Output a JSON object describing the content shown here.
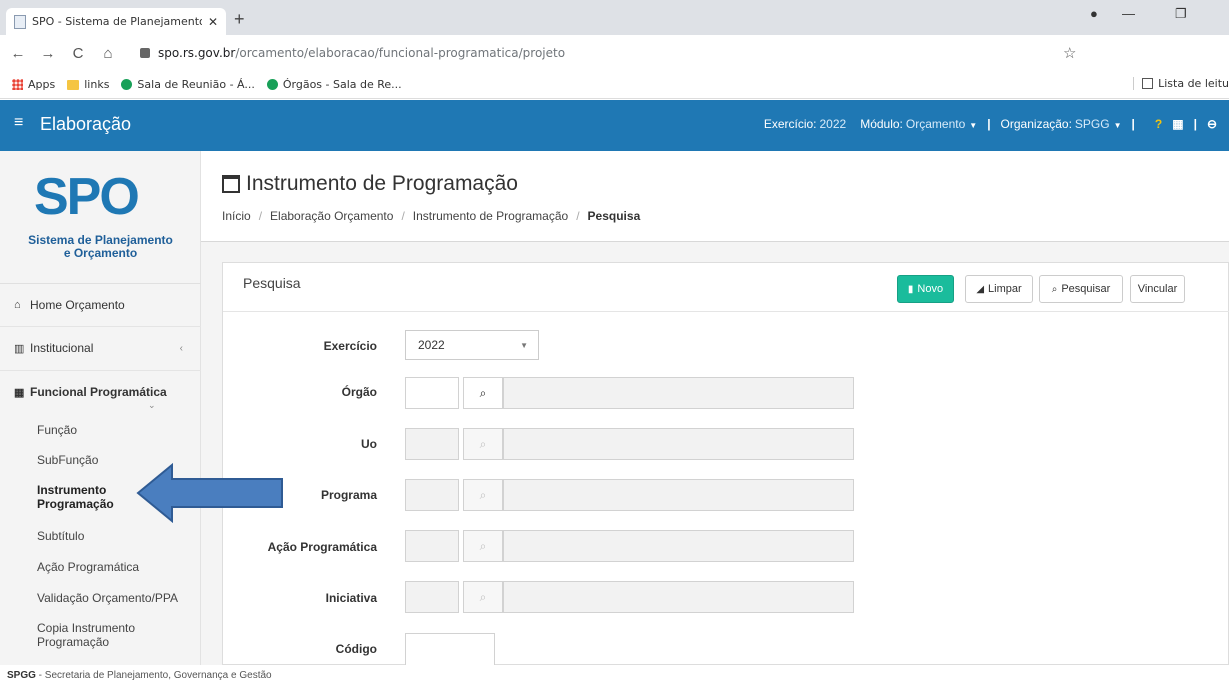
{
  "browser": {
    "tab_title": "SPO - Sistema de Planejamento e",
    "url_host": "spo.rs.gov.br",
    "url_path": "/orcamento/elaboracao/funcional-programatica/projeto",
    "bookmarks": [
      "Apps",
      "links",
      "Sala de Reunião - Á...",
      "Órgãos - Sala de Re..."
    ],
    "reading_list": "Lista de leitu"
  },
  "header": {
    "brand": "Elaboração",
    "exercicio_label": "Exercício:",
    "exercicio_value": "2022",
    "modulo_label": "Módulo:",
    "modulo_value": "Orçamento",
    "org_label": "Organização:",
    "org_value": "SPGG"
  },
  "logo": {
    "letters": "SPO",
    "tagline_1": "Sistema de Planejamento",
    "tagline_2": "e Orçamento"
  },
  "sidebar": {
    "home": "Home Orçamento",
    "institucional": "Institucional",
    "funcional": "Funcional Programática",
    "sub": [
      "Função",
      "SubFunção",
      "Instrumento",
      "Programação",
      "Subtítulo",
      "Ação Programática",
      "Validação Orçamento/PPA",
      "Copia Instrumento",
      "Programação"
    ]
  },
  "page": {
    "title": "Instrumento de Programação",
    "breadcrumb": [
      "Início",
      "Elaboração Orçamento",
      "Instrumento de Programação",
      "Pesquisa"
    ]
  },
  "panel": {
    "title": "Pesquisa",
    "btn_novo": "Novo",
    "btn_limpar": "Limpar",
    "btn_pesquisar": "Pesquisar",
    "btn_vincular": "Vincular"
  },
  "form": {
    "exercicio_label": "Exercício",
    "exercicio_value": "2022",
    "orgao_label": "Órgão",
    "uo_label": "Uo",
    "programa_label": "Programa",
    "acao_label": "Ação Programática",
    "iniciativa_label": "Iniciativa",
    "codigo_label": "Código"
  },
  "footer": {
    "abbr": "SPGG",
    "text": " - Secretaria de Planejamento, Governança e Gestão"
  },
  "colors": {
    "header_blue": "#1f78b4",
    "novo_green": "#1abc9c",
    "arrow_blue": "#4a7ebf"
  }
}
